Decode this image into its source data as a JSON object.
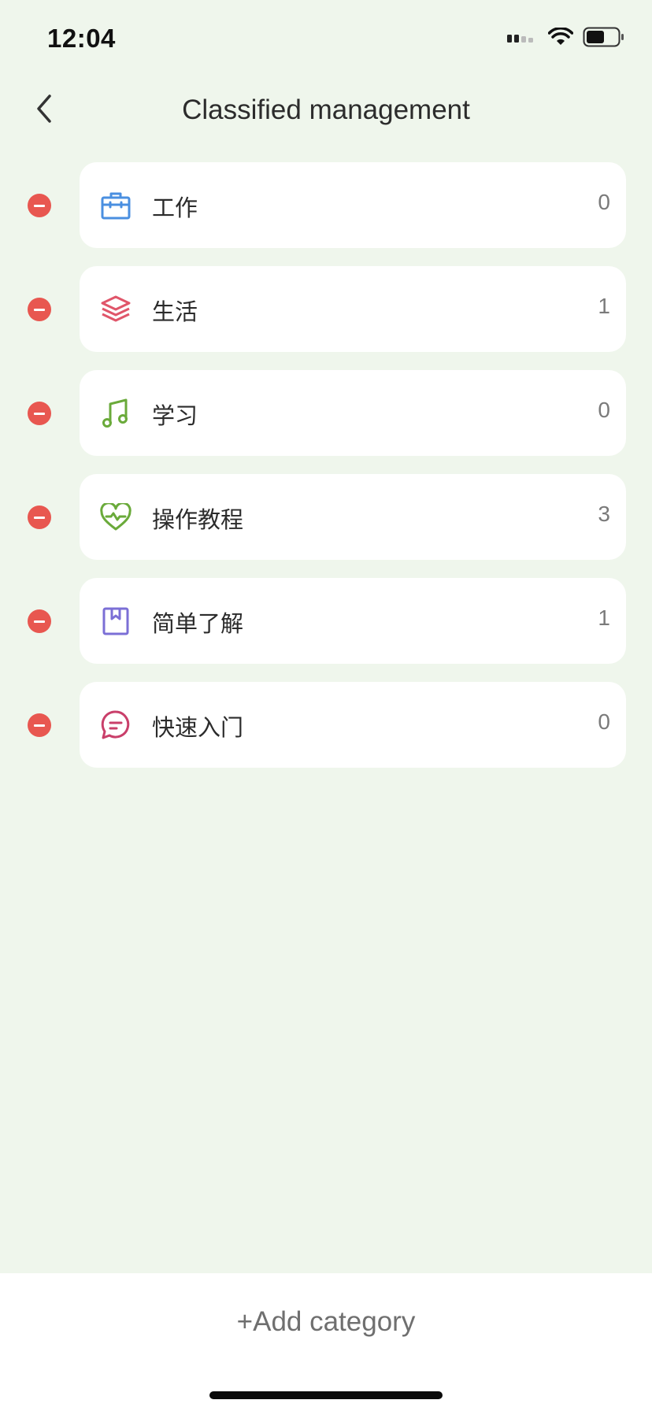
{
  "status_bar": {
    "time": "12:04",
    "icons": [
      "signal-icon",
      "wifi-icon",
      "battery-icon"
    ]
  },
  "nav": {
    "title": "Classified management",
    "back_icon": "chevron-left-icon"
  },
  "categories": [
    {
      "name": "工作",
      "count": "0",
      "icon": "briefcase-icon",
      "color": "#4a8fe0"
    },
    {
      "name": "生活",
      "count": "1",
      "icon": "layers-icon",
      "color": "#e0566a"
    },
    {
      "name": "学习",
      "count": "0",
      "icon": "music-note-icon",
      "color": "#6aaa3a"
    },
    {
      "name": "操作教程",
      "count": "3",
      "icon": "heart-pulse-icon",
      "color": "#6aaa3a"
    },
    {
      "name": "简单了解",
      "count": "1",
      "icon": "bookmark-book-icon",
      "color": "#7b6fd6"
    },
    {
      "name": "快速入门",
      "count": "0",
      "icon": "chat-bubble-icon",
      "color": "#c93f6a"
    }
  ],
  "actions": {
    "add_category": "+Add category"
  },
  "colors": {
    "background": "#eff6ec",
    "delete_red": "#e85750",
    "card": "#ffffff"
  }
}
